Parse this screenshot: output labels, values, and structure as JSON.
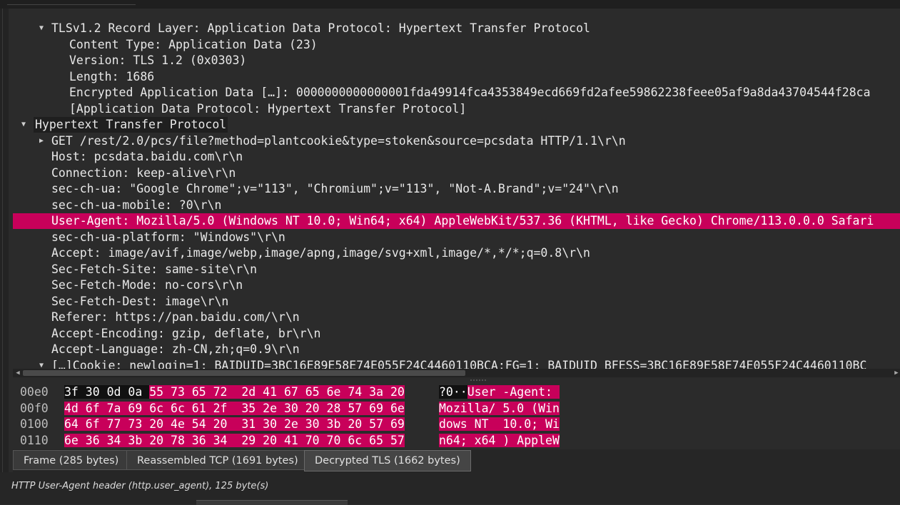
{
  "details": {
    "rows": [
      {
        "text": "TLSv1.2 Record Layer: Application Data Protocol: Hypertext Transfer Protocol",
        "indent": 2,
        "expander": "down"
      },
      {
        "text": "Content Type: Application Data (23)",
        "indent": 3
      },
      {
        "text": "Version: TLS 1.2 (0x0303)",
        "indent": 3
      },
      {
        "text": "Length: 1686",
        "indent": 3
      },
      {
        "text": "Encrypted Application Data […]: 0000000000000001fda49914fca4353849ecd669fd2afee59862238feee05af9a8da43704544f28ca",
        "indent": 3
      },
      {
        "text": "[Application Data Protocol: Hypertext Transfer Protocol]",
        "indent": 3
      },
      {
        "text": "Hypertext Transfer Protocol",
        "indent": 1,
        "expander": "down",
        "header": true
      },
      {
        "text": "GET /rest/2.0/pcs/file?method=plantcookie&type=stoken&source=pcsdata HTTP/1.1\\r\\n",
        "indent": 2,
        "expander": "right"
      },
      {
        "text": "Host: pcsdata.baidu.com\\r\\n",
        "indent": 2
      },
      {
        "text": "Connection: keep-alive\\r\\n",
        "indent": 2
      },
      {
        "text": "sec-ch-ua: \"Google Chrome\";v=\"113\", \"Chromium\";v=\"113\", \"Not-A.Brand\";v=\"24\"\\r\\n",
        "indent": 2
      },
      {
        "text": "sec-ch-ua-mobile: ?0\\r\\n",
        "indent": 2
      },
      {
        "text": "User-Agent: Mozilla/5.0 (Windows NT 10.0; Win64; x64) AppleWebKit/537.36 (KHTML, like Gecko) Chrome/113.0.0.0 Safari",
        "indent": 2,
        "selected": true
      },
      {
        "text": "sec-ch-ua-platform: \"Windows\"\\r\\n",
        "indent": 2
      },
      {
        "text": "Accept: image/avif,image/webp,image/apng,image/svg+xml,image/*,*/*;q=0.8\\r\\n",
        "indent": 2
      },
      {
        "text": "Sec-Fetch-Site: same-site\\r\\n",
        "indent": 2
      },
      {
        "text": "Sec-Fetch-Mode: no-cors\\r\\n",
        "indent": 2
      },
      {
        "text": "Sec-Fetch-Dest: image\\r\\n",
        "indent": 2
      },
      {
        "text": "Referer: https://pan.baidu.com/\\r\\n",
        "indent": 2
      },
      {
        "text": "Accept-Encoding: gzip, deflate, br\\r\\n",
        "indent": 2
      },
      {
        "text": "Accept-Language: zh-CN,zh;q=0.9\\r\\n",
        "indent": 2
      },
      {
        "text": "[…]Cookie: newlogin=1; BAIDUID=3BC16E89E58E74E055F24C4460110BCA:FG=1; BAIDUID_BFESS=3BC16E89E58E74E055F24C4460110BC",
        "indent": 2,
        "expander": "down"
      }
    ]
  },
  "bytes": {
    "rows": [
      {
        "offset": "00e0",
        "hex_pre": "3f 30 0d 0a",
        "hex_sel": "55 73 65 72  2d 41 67 65 6e 74 3a 20",
        "ascii_pre": "?0··",
        "ascii_sel": "User -Agent: "
      },
      {
        "offset": "00f0",
        "hex_pre": "",
        "hex_sel": "4d 6f 7a 69 6c 6c 61 2f  35 2e 30 20 28 57 69 6e",
        "ascii_pre": "",
        "ascii_sel": "Mozilla/ 5.0 (Win"
      },
      {
        "offset": "0100",
        "hex_pre": "",
        "hex_sel": "64 6f 77 73 20 4e 54 20  31 30 2e 30 3b 20 57 69",
        "ascii_pre": "",
        "ascii_sel": "dows NT  10.0; Wi"
      },
      {
        "offset": "0110",
        "hex_pre": "",
        "hex_sel": "6e 36 34 3b 20 78 36 34  29 20 41 70 70 6c 65 57",
        "ascii_pre": "",
        "ascii_sel": "n64; x64 ) AppleW"
      }
    ]
  },
  "tabs": [
    {
      "label": "Frame (285 bytes)",
      "active": false
    },
    {
      "label": "Reassembled TCP (1691 bytes)",
      "active": false
    },
    {
      "label": "Decrypted TLS (1662 bytes)",
      "active": true
    }
  ],
  "status": {
    "text": "HTTP User-Agent header (http.user_agent), 125 byte(s)"
  },
  "colors": {
    "selection": "#c8005a",
    "background": "#2b2b2b"
  }
}
